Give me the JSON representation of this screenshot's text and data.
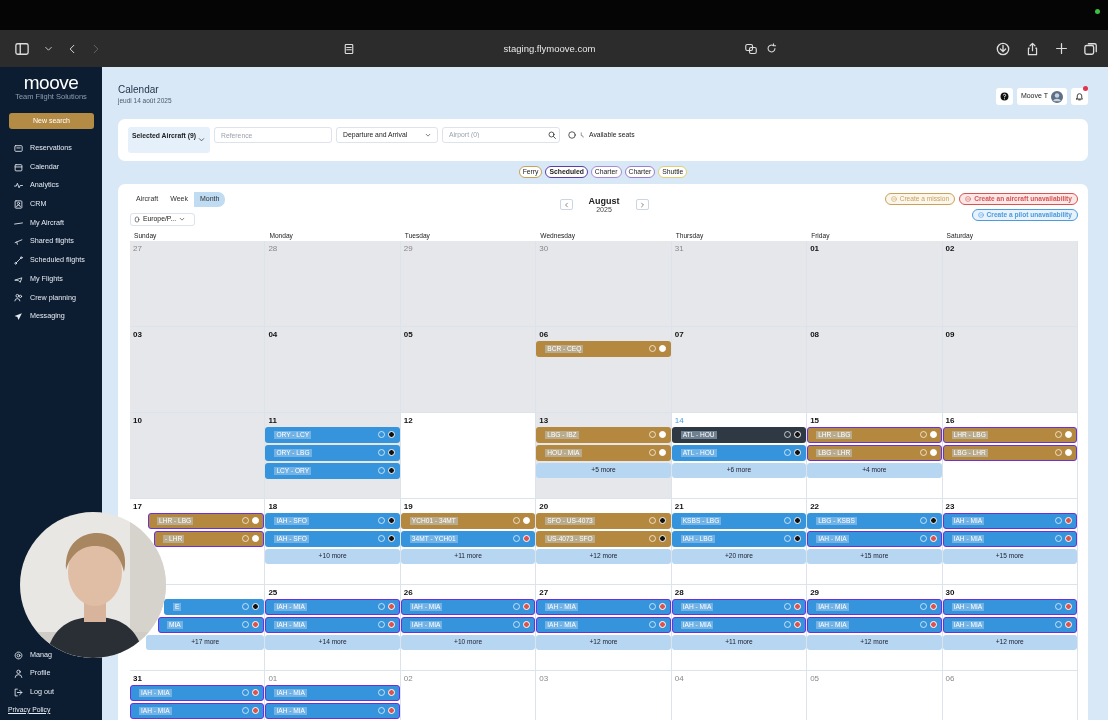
{
  "browser": {
    "url": "staging.flymoove.com"
  },
  "sidebar": {
    "logo": "moove",
    "tagline": "Team Flight Solutions",
    "new_search": "New search",
    "items": [
      {
        "label": "Reservations"
      },
      {
        "label": "Calendar"
      },
      {
        "label": "Analytics"
      },
      {
        "label": "CRM"
      },
      {
        "label": "My Aircraft"
      },
      {
        "label": "Shared flights"
      },
      {
        "label": "Scheduled flights"
      },
      {
        "label": "My Flights"
      },
      {
        "label": "Crew planning"
      },
      {
        "label": "Messaging"
      }
    ],
    "bottom_items": [
      {
        "label": "Manag"
      },
      {
        "label": "Profile"
      },
      {
        "label": "Log out"
      }
    ],
    "privacy": "Privacy Policy"
  },
  "header": {
    "title": "Calendar",
    "date": "jeudi 14 août 2025",
    "user": "Moove T",
    "notifications": true
  },
  "filters": {
    "aircraft": "Selected Aircraft (9)",
    "reference": {
      "placeholder": "Reference"
    },
    "route_mode": "Departure and Arrival",
    "airport": {
      "placeholder": "Airport (0)"
    },
    "available_seats": {
      "label": "Available seats",
      "checked": false
    }
  },
  "chips": [
    {
      "label": "Ferry",
      "color": "#c9a15a",
      "selected": false
    },
    {
      "label": "Scheduled",
      "color": "#5b3fa6",
      "selected": true
    },
    {
      "label": "Charter",
      "color": "#a98ad6",
      "selected": false
    },
    {
      "label": "Charter",
      "color": "#9a7fd0",
      "selected": false
    },
    {
      "label": "Shuttle",
      "color": "#e2d070",
      "selected": false
    }
  ],
  "views": [
    {
      "label": "Aircraft",
      "selected": false
    },
    {
      "label": "Week",
      "selected": false
    },
    {
      "label": "Month",
      "selected": true
    }
  ],
  "timezone": "Europe/P...",
  "month": {
    "name": "August",
    "year": "2025"
  },
  "actions": [
    {
      "label": "Create a mission",
      "color": "#c9a15a",
      "disabled": true
    },
    {
      "label": "Create an aircraft unavailability",
      "color": "#d9534f",
      "disabled": false
    },
    {
      "label": "Create a pilot unavailability",
      "color": "#4a9be0",
      "disabled": false
    }
  ],
  "weekdays": [
    "Sunday",
    "Monday",
    "Tuesday",
    "Wednesday",
    "Thursday",
    "Friday",
    "Saturday"
  ],
  "weeks": [
    [
      {
        "day": "27",
        "muted": true,
        "today": false,
        "shaded": true
      },
      {
        "day": "28",
        "muted": true,
        "today": false,
        "shaded": true
      },
      {
        "day": "29",
        "muted": true,
        "today": false,
        "shaded": true
      },
      {
        "day": "30",
        "muted": true,
        "today": false,
        "shaded": true
      },
      {
        "day": "31",
        "muted": true,
        "today": false,
        "shaded": true
      },
      {
        "day": "01",
        "muted": false,
        "today": false,
        "shaded": true
      },
      {
        "day": "02",
        "muted": false,
        "today": false,
        "shaded": true
      }
    ],
    [
      {
        "day": "03",
        "muted": false,
        "today": false,
        "shaded": true
      },
      {
        "day": "04",
        "muted": false,
        "today": false,
        "shaded": true
      },
      {
        "day": "05",
        "muted": false,
        "today": false,
        "shaded": true
      },
      {
        "day": "06",
        "muted": false,
        "today": false,
        "shaded": true,
        "events": [
          {
            "route": "BCR - CEQ",
            "color": "#b5883f",
            "outlined": false,
            "status": {
              "color": "#ffffff"
            }
          }
        ]
      },
      {
        "day": "07",
        "muted": false,
        "today": false,
        "shaded": true
      },
      {
        "day": "08",
        "muted": false,
        "today": false,
        "shaded": true
      },
      {
        "day": "09",
        "muted": false,
        "today": false,
        "shaded": true
      }
    ],
    [
      {
        "day": "10",
        "muted": false,
        "today": false,
        "shaded": true
      },
      {
        "day": "11",
        "muted": false,
        "today": false,
        "shaded": true,
        "events": [
          {
            "route": "ORY - LCY",
            "color": "#3594dc",
            "outlined": false,
            "status": {
              "color": "#111111"
            }
          },
          {
            "route": "ORY - LBG",
            "color": "#3594dc",
            "outlined": false,
            "status": {
              "color": "#111111"
            }
          },
          {
            "route": "LCY - ORY",
            "color": "#3594dc",
            "outlined": false,
            "status": {
              "color": "#111111"
            }
          }
        ]
      },
      {
        "day": "12",
        "muted": false,
        "today": false,
        "shaded": false
      },
      {
        "day": "13",
        "muted": false,
        "today": false,
        "shaded": true,
        "events": [
          {
            "route": "LBG - IBZ",
            "color": "#b5883f",
            "outlined": false,
            "status": {
              "color": "#ffffff"
            }
          },
          {
            "route": "HOU - MIA",
            "color": "#b5883f",
            "outlined": false,
            "status": {
              "color": "#ffffff"
            }
          }
        ],
        "more": "+5 more"
      },
      {
        "day": "14",
        "muted": false,
        "today": true,
        "shaded": false,
        "events": [
          {
            "route": "ATL - HOU",
            "color": "#2e3944",
            "outlined": false,
            "status": {
              "color": "#111111"
            }
          },
          {
            "route": "ATL - HOU",
            "color": "#3594dc",
            "outlined": false,
            "status": {
              "color": "#111111"
            }
          }
        ],
        "more": "+6 more"
      },
      {
        "day": "15",
        "muted": false,
        "today": false,
        "shaded": false,
        "events": [
          {
            "route": "LHR - LBG",
            "color": "#b5883f",
            "outlined": true,
            "status": {
              "color": "#ffffff"
            }
          },
          {
            "route": "LBG - LHR",
            "color": "#b5883f",
            "outlined": true,
            "status": {
              "color": "#ffffff"
            }
          }
        ],
        "more": "+4 more"
      },
      {
        "day": "16",
        "muted": false,
        "today": false,
        "shaded": false,
        "events": [
          {
            "route": "LHR - LBG",
            "color": "#b5883f",
            "outlined": true,
            "status": {
              "color": "#ffffff"
            }
          },
          {
            "route": "LBG - LHR",
            "color": "#b5883f",
            "outlined": true,
            "status": {
              "color": "#ffffff"
            }
          }
        ]
      }
    ],
    [
      {
        "day": "17",
        "muted": false,
        "today": false,
        "shaded": false,
        "events": [
          {
            "route": "LHR - LBG",
            "color": "#b5883f",
            "outlined": true,
            "status": {
              "color": "#ffffff"
            }
          },
          {
            "route": "- LHR",
            "color": "#b5883f",
            "outlined": true,
            "status": {
              "color": "#ffffff"
            }
          }
        ]
      },
      {
        "day": "18",
        "muted": false,
        "today": false,
        "shaded": false,
        "events": [
          {
            "route": "IAH - SFO",
            "color": "#3594dc",
            "outlined": false,
            "status": {
              "color": "#111111"
            }
          },
          {
            "route": "IAH - SFO",
            "color": "#3594dc",
            "outlined": false,
            "status": {
              "color": "#111111"
            }
          }
        ],
        "more": "+10 more"
      },
      {
        "day": "19",
        "muted": false,
        "today": false,
        "shaded": false,
        "events": [
          {
            "route": "YCH01 - 34MT",
            "color": "#b5883f",
            "outlined": false,
            "status": {
              "color": "#ffffff"
            }
          },
          {
            "route": "34MT - YCH01",
            "color": "#3594dc",
            "outlined": false,
            "status": {
              "color": "#d9534f"
            }
          }
        ],
        "more": "+11 more"
      },
      {
        "day": "20",
        "muted": false,
        "today": false,
        "shaded": false,
        "events": [
          {
            "route": "SFO - US-4073",
            "color": "#b5883f",
            "outlined": false,
            "status": {
              "color": "#111111"
            }
          },
          {
            "route": "US-4073 - SFO",
            "color": "#b5883f",
            "outlined": false,
            "status": {
              "color": "#111111"
            }
          }
        ],
        "more": "+12 more"
      },
      {
        "day": "21",
        "muted": false,
        "today": false,
        "shaded": false,
        "events": [
          {
            "route": "KSBS - LBG",
            "color": "#3594dc",
            "outlined": false,
            "status": {
              "color": "#111111"
            }
          },
          {
            "route": "IAH - LBG",
            "color": "#3594dc",
            "outlined": false,
            "status": {
              "color": "#111111"
            }
          }
        ],
        "more": "+20 more"
      },
      {
        "day": "22",
        "muted": false,
        "today": false,
        "shaded": false,
        "events": [
          {
            "route": "LBG - KSBS",
            "color": "#3594dc",
            "outlined": false,
            "status": {
              "color": "#111111"
            }
          },
          {
            "route": "IAH - MIA",
            "color": "#3594dc",
            "outlined": true,
            "status": {
              "color": "#d9534f"
            }
          }
        ],
        "more": "+15 more"
      },
      {
        "day": "23",
        "muted": false,
        "today": false,
        "shaded": false,
        "events": [
          {
            "route": "IAH - MIA",
            "color": "#3594dc",
            "outlined": true,
            "status": {
              "color": "#d9534f"
            }
          },
          {
            "route": "IAH - MIA",
            "color": "#3594dc",
            "outlined": true,
            "status": {
              "color": "#d9534f"
            }
          }
        ],
        "more": "+15 more"
      }
    ],
    [
      {
        "events": [
          {
            "route": "E",
            "color": "#3594dc",
            "outlined": false,
            "status": {
              "color": "#111111"
            }
          },
          {
            "route": "MIA",
            "color": "#3594dc",
            "outlined": true,
            "status": {
              "color": "#d9534f"
            }
          }
        ],
        "more": "+17 more"
      },
      {
        "day": "25",
        "muted": false,
        "today": false,
        "shaded": false,
        "events": [
          {
            "route": "IAH - MIA",
            "color": "#3594dc",
            "outlined": true,
            "status": {
              "color": "#d9534f"
            }
          },
          {
            "route": "IAH - MIA",
            "color": "#3594dc",
            "outlined": true,
            "status": {
              "color": "#d9534f"
            }
          }
        ],
        "more": "+14 more"
      },
      {
        "day": "26",
        "muted": false,
        "today": false,
        "shaded": false,
        "events": [
          {
            "route": "IAH - MIA",
            "color": "#3594dc",
            "outlined": true,
            "status": {
              "color": "#d9534f"
            }
          },
          {
            "route": "IAH - MIA",
            "color": "#3594dc",
            "outlined": true,
            "status": {
              "color": "#d9534f"
            }
          }
        ],
        "more": "+10 more"
      },
      {
        "day": "27",
        "muted": false,
        "today": false,
        "shaded": false,
        "events": [
          {
            "route": "IAH - MIA",
            "color": "#3594dc",
            "outlined": true,
            "status": {
              "color": "#d9534f"
            }
          },
          {
            "route": "IAH - MIA",
            "color": "#3594dc",
            "outlined": true,
            "status": {
              "color": "#d9534f"
            }
          }
        ],
        "more": "+12 more"
      },
      {
        "day": "28",
        "muted": false,
        "today": false,
        "shaded": false,
        "events": [
          {
            "route": "IAH - MIA",
            "color": "#3594dc",
            "outlined": true,
            "status": {
              "color": "#d9534f"
            }
          },
          {
            "route": "IAH - MIA",
            "color": "#3594dc",
            "outlined": true,
            "status": {
              "color": "#d9534f"
            }
          }
        ],
        "more": "+11 more"
      },
      {
        "day": "29",
        "muted": false,
        "today": false,
        "shaded": false,
        "events": [
          {
            "route": "IAH - MIA",
            "color": "#3594dc",
            "outlined": true,
            "status": {
              "color": "#d9534f"
            }
          },
          {
            "route": "IAH - MIA",
            "color": "#3594dc",
            "outlined": true,
            "status": {
              "color": "#d9534f"
            }
          }
        ],
        "more": "+12 more"
      },
      {
        "day": "30",
        "muted": false,
        "today": false,
        "shaded": false,
        "events": [
          {
            "route": "IAH - MIA",
            "color": "#3594dc",
            "outlined": true,
            "status": {
              "color": "#d9534f"
            }
          },
          {
            "route": "IAH - MIA",
            "color": "#3594dc",
            "outlined": true,
            "status": {
              "color": "#d9534f"
            }
          }
        ],
        "more": "+12 more"
      }
    ],
    [
      {
        "day": "31",
        "muted": false,
        "today": false,
        "shaded": false,
        "events": [
          {
            "route": "IAH - MIA",
            "color": "#3594dc",
            "outlined": true,
            "status": {
              "color": "#d9534f"
            }
          },
          {
            "route": "IAH - MIA",
            "color": "#3594dc",
            "outlined": true,
            "status": {
              "color": "#d9534f"
            }
          }
        ]
      },
      {
        "day": "01",
        "muted": true,
        "today": false,
        "shaded": false,
        "events": [
          {
            "route": "IAH - MIA",
            "color": "#3594dc",
            "outlined": true,
            "status": {
              "color": "#d9534f"
            }
          },
          {
            "route": "IAH - MIA",
            "color": "#3594dc",
            "outlined": true,
            "status": {
              "color": "#d9534f"
            }
          }
        ]
      },
      {
        "day": "02",
        "muted": true,
        "today": false,
        "shaded": false
      },
      {
        "day": "03",
        "muted": true,
        "today": false,
        "shaded": false
      },
      {
        "day": "04",
        "muted": true,
        "today": false,
        "shaded": false
      },
      {
        "day": "05",
        "muted": true,
        "today": false,
        "shaded": false
      },
      {
        "day": "06",
        "muted": true,
        "today": false,
        "shaded": false
      }
    ]
  ]
}
